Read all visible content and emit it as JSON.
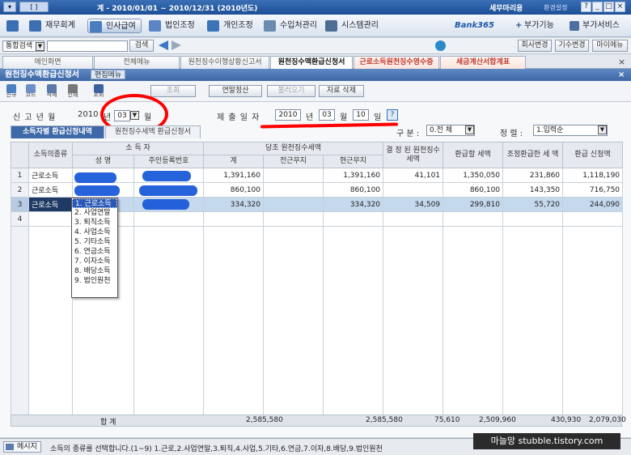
{
  "titlebar": {
    "title": "계 - 2010/01/01 ~ 2010/12/31 (2010년도)",
    "app": "세무마리용",
    "small": "환경설정",
    "left": "[  ]"
  },
  "menu": [
    {
      "label": "재무회계",
      "color": "#3d6fb0"
    },
    {
      "label": "인사급여",
      "color": "#4a7cc0"
    },
    {
      "label": "법인조정",
      "color": "#5a86c4"
    },
    {
      "label": "개인조정",
      "color": "#3b74b9"
    },
    {
      "label": "수입처관리",
      "color": "#6c8ab0"
    },
    {
      "label": "시스템관리",
      "color": "#4d6d95"
    }
  ],
  "menu_right": {
    "bank": "Bank365",
    "vat": "부가기능",
    "service": "부가서비스"
  },
  "search": {
    "combo": "통합검색",
    "button": "검색",
    "right_buttons": [
      "회사변경",
      "기수변경",
      "마이메뉴"
    ]
  },
  "tabs": [
    "메인화면",
    "전체메뉴",
    "원천징수이행상황신고서",
    "원천징수액환급신청서",
    "근로소득원천징수영수증",
    "세금계산서합계표"
  ],
  "form": {
    "title": "원천징수액환급신청서",
    "mode": "편집메뉴"
  },
  "toolbar": {
    "icons": [
      "신규",
      "코드",
      "삭제",
      "인쇄",
      "조회"
    ],
    "b1": "조회",
    "b2": "연말정산",
    "b3": "불러오기",
    "b4": "자료 삭제"
  },
  "header": {
    "report_label": "신 고 년 월",
    "year": "2010",
    "year_unit": "년",
    "month": "03",
    "month_unit": "월",
    "submit_label": "제 출 일 자",
    "submit_year": "2010",
    "submit_month": "03",
    "submit_day": "10",
    "unit_year": "년",
    "unit_month": "월",
    "unit_day": "일",
    "type_label": "구 분 :",
    "type_value": "0.전     체",
    "sort_label": "정 렬 :",
    "sort_value": "1.입력순"
  },
  "subtabs": [
    "소득자별 환급신청내역",
    "원천징수세액 환급신청서"
  ],
  "columns": {
    "kind": "소득의종류",
    "earner": "소 득 자",
    "name": "성  명",
    "rrn": "주민등록번호",
    "tax_group": "당초 원천징수세액",
    "total": "계",
    "prev_employer": "전근무지",
    "curr_employer": "현근무지",
    "decided": "결 정 된 원천징수세액",
    "refund_tax": "환급할 세액",
    "adjust": "조정환급한 세  액",
    "apply": "환급 신청액"
  },
  "rows": [
    {
      "no": "1",
      "kind": "근로소득",
      "total": "1,391,160",
      "prev": "",
      "curr": "1,391,160",
      "decided": "41,101",
      "refund": "1,350,050",
      "adjust": "231,860",
      "apply": "1,118,190"
    },
    {
      "no": "2",
      "kind": "근로소득",
      "total": "860,100",
      "prev": "",
      "curr": "860,100",
      "decided": "",
      "refund": "860,100",
      "adjust": "143,350",
      "apply": "716,750"
    },
    {
      "no": "3",
      "kind": "근로소득",
      "total": "334,320",
      "prev": "",
      "curr": "334,320",
      "decided": "34,509",
      "refund": "299,810",
      "adjust": "55,720",
      "apply": "244,090"
    },
    {
      "no": "4",
      "kind": "",
      "total": "",
      "prev": "",
      "curr": "",
      "decided": "",
      "refund": "",
      "adjust": "",
      "apply": ""
    }
  ],
  "dropdown": [
    "1. 근로소득",
    "2. 사업연말",
    "3. 퇴직소득",
    "4. 사업소득",
    "5. 기타소득",
    "6. 연금소득",
    "7. 이자소득",
    "8. 배당소득",
    "9. 법인원천"
  ],
  "totals": {
    "label": "합    계",
    "total": "2,585,580",
    "curr": "2,585,580",
    "decided": "75,610",
    "refund": "2,509,960",
    "adjust": "430,930",
    "apply": "2,079,030"
  },
  "status": {
    "label": "메시지",
    "message": "소득의 종류를 선택합니다.(1~9) 1.근로,2.사업연말,3.퇴직,4.사업,5.기타,6.연금,7.이자,8.배당,9.법인원천"
  },
  "watermark": "마늘망 stubble.tistory.com"
}
